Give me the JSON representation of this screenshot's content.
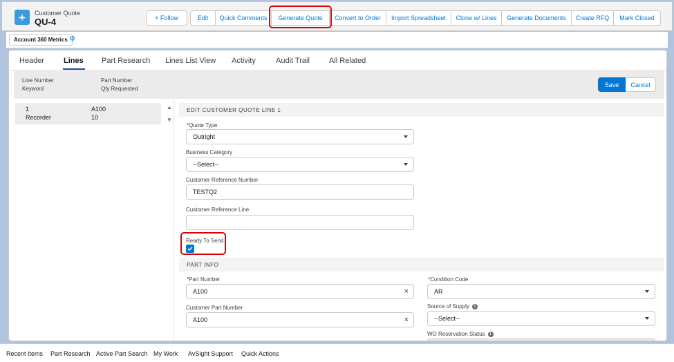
{
  "record": {
    "object_type": "Customer Quote",
    "name": "QU-4"
  },
  "actions": [
    {
      "label": "+ Follow"
    },
    {
      "label": "Edit"
    },
    {
      "label": "Quick Comments"
    },
    {
      "label": "Generate Quote"
    },
    {
      "label": "Convert to Order"
    },
    {
      "label": "Import Spreadsheet"
    },
    {
      "label": "Clone w/ Lines"
    },
    {
      "label": "Generate Documents"
    },
    {
      "label": "Create RFQ"
    },
    {
      "label": "Mark Closed"
    }
  ],
  "ribbon": {
    "account_metrics": "Account 360 Metrics",
    "settings_icon": "gear-icon"
  },
  "tabs": [
    "Header",
    "Lines",
    "Part Research",
    "Lines List View",
    "Activity",
    "Audit Trail",
    "All Related"
  ],
  "active_tab": "Lines",
  "filterbar": {
    "col1_line1": "Line Number",
    "col1_line2": "Keyword",
    "col2_line1": "Part Number",
    "col2_line2": "Qty Requested",
    "save_label": "Save",
    "cancel_label": "Cancel"
  },
  "line_list": [
    {
      "line_number": "1",
      "keyword": "Recorder",
      "part_number": "A100",
      "qty": "10"
    }
  ],
  "edit_section": {
    "title": "EDIT CUSTOMER QUOTE LINE 1",
    "quote_type_label": "Quote Type",
    "quote_type_value": "Outright",
    "business_category_label": "Business Category",
    "business_category_value": "--Select--",
    "customer_ref_number_label": "Customer Reference Number",
    "customer_ref_number_value": "TESTQ2",
    "customer_ref_line_label": "Customer Reference Line",
    "customer_ref_line_value": "",
    "ready_to_send_label": "Ready To Send",
    "ready_to_send_checked": true
  },
  "part_info": {
    "title": "PART INFO",
    "part_number_label": "Part Number",
    "part_number_value": "A100",
    "customer_part_number_label": "Customer Part Number",
    "customer_part_number_value": "A100",
    "condition_code_label": "Condition Code",
    "condition_code_value": "AR",
    "source_of_supply_label": "Source of Supply",
    "source_of_supply_value": "--Select--",
    "wo_reservation_label": "WO Reservation Status"
  },
  "utility_bar": [
    "Recent Items",
    "Part Research",
    "Active Part Search",
    "My Work",
    "AvSight Support",
    "Quick Actions"
  ],
  "colors": {
    "brand_blue": "#0176d3",
    "highlight_red": "#e00000",
    "background": "#b0c4df"
  }
}
